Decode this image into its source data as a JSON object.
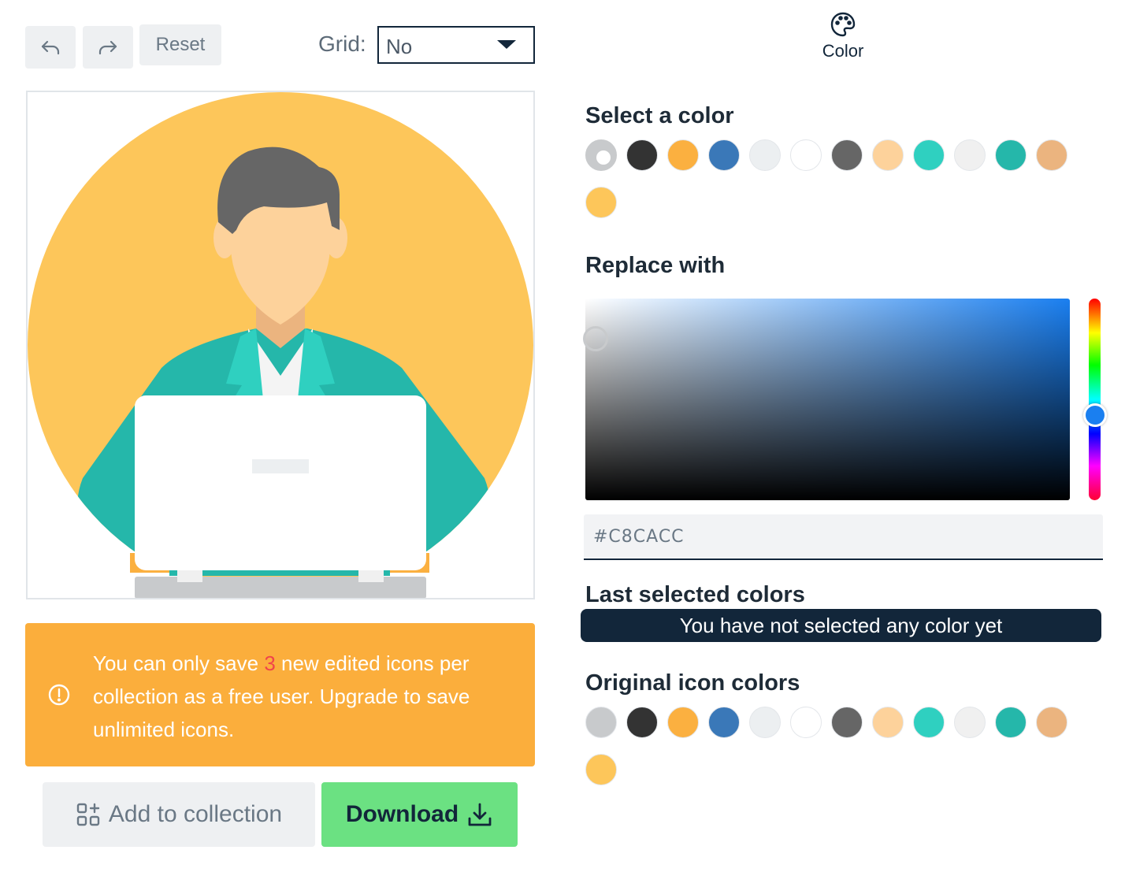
{
  "toolbar": {
    "undo_icon": "undo-icon",
    "redo_icon": "redo-icon",
    "reset_label": "Reset",
    "grid_label": "Grid:",
    "grid_value": "No"
  },
  "banner": {
    "text_before": "You can only save ",
    "count": "3",
    "text_after": " new edited icons per collection as a free user. Upgrade to save unlimited icons.",
    "icon": "info-icon"
  },
  "actions": {
    "add_label": "Add to collection",
    "download_label": "Download"
  },
  "tabs": {
    "color_label": "Color",
    "color_icon": "palette-icon"
  },
  "select_color": {
    "title": "Select a color",
    "colors": [
      "#c8cacc",
      "#333333",
      "#fbb040",
      "#3a78b8",
      "#eceff1",
      "#ffffff",
      "#666666",
      "#fdd29b",
      "#2fd0c0",
      "#f0f0f0",
      "#25b7aa",
      "#ebb47f",
      "#fdc65a"
    ],
    "selected_index": 0
  },
  "replace_with": {
    "title": "Replace with",
    "hex_value": "#C8CACC",
    "hue_color": "#1a7ff0"
  },
  "last_selected": {
    "title": "Last selected colors",
    "empty_message": "You have not selected any color yet"
  },
  "original_colors": {
    "title": "Original icon colors",
    "colors": [
      "#c8cacc",
      "#333333",
      "#fbb040",
      "#3a78b8",
      "#eceff1",
      "#ffffff",
      "#666666",
      "#fdd29b",
      "#2fd0c0",
      "#f0f0f0",
      "#25b7aa",
      "#ebb47f",
      "#fdc65a"
    ]
  }
}
